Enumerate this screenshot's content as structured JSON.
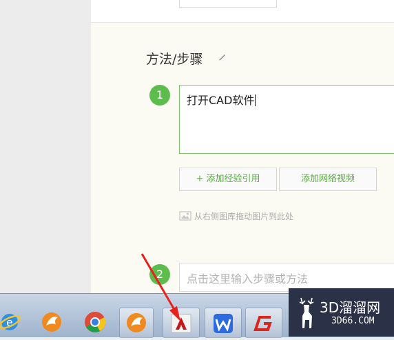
{
  "section": {
    "title": "方法/步骤"
  },
  "steps": [
    {
      "number": "1",
      "text": "打开CAD软件"
    },
    {
      "number": "2",
      "placeholder": "点击这里输入步骤或方法"
    }
  ],
  "buttons": {
    "add_quote": "+ 添加经验引用",
    "add_video": "添加网络视频"
  },
  "drag_hint": "从右侧图库拖动图片到此处",
  "watermark": {
    "brand": "3D溜溜网",
    "domain": "3D66.COM"
  },
  "taskbar": {
    "apps": [
      {
        "icon": "internet-explorer-icon"
      },
      {
        "icon": "browser-fox-icon"
      },
      {
        "icon": "chrome-icon"
      },
      {
        "icon": "browser-fox-icon"
      },
      {
        "icon": "autocad-icon"
      },
      {
        "icon": "wps-icon"
      },
      {
        "icon": "red-g-app-icon"
      }
    ]
  },
  "colors": {
    "accent_green": "#5cbd4c",
    "annotation_red": "#e8211c",
    "watermark_bg": "#2b3146"
  }
}
